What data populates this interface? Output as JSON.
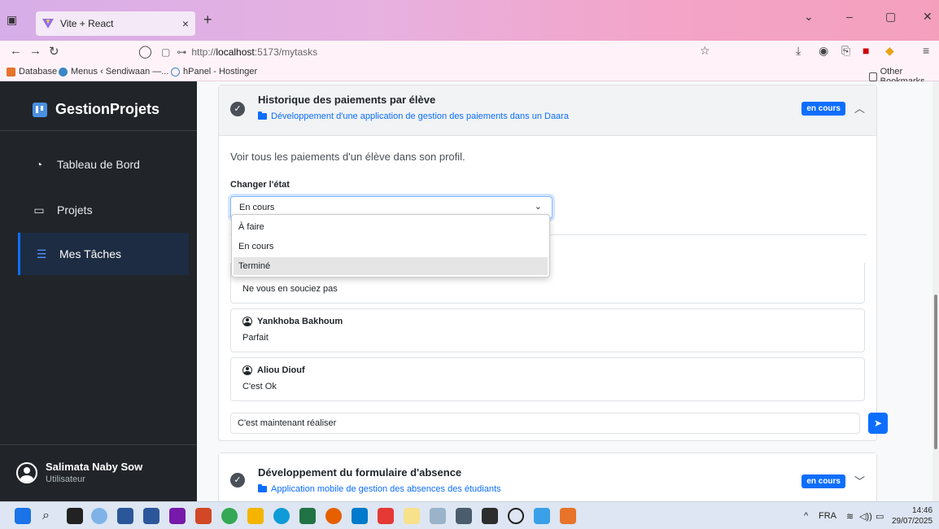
{
  "browser": {
    "tab_title": "Vite + React",
    "tab_close": "×",
    "new_tab": "+",
    "url_prefix": "http://",
    "url_host": "localhost",
    "url_rest": ":5173/mytasks",
    "bookmarks": [
      {
        "label": "Database",
        "color": "#e8732a"
      },
      {
        "label": "Menus ‹ Sendiwaan —...",
        "color": "#3b87c6"
      },
      {
        "label": "hPanel - Hostinger",
        "color": "#3b87c6"
      }
    ],
    "other_bookmarks": "Other Bookmarks"
  },
  "sidebar": {
    "brand": "GestionProjets",
    "items": [
      {
        "label": "Tableau de Bord",
        "icon": "gauge-icon"
      },
      {
        "label": "Projets",
        "icon": "folder-icon"
      },
      {
        "label": "Mes Tâches",
        "icon": "list-icon"
      }
    ],
    "user": {
      "name": "Salimata Naby Sow",
      "role": "Utilisateur"
    }
  },
  "task1": {
    "title": "Historique des paiements par élève",
    "project": "Développement d'une application de gestion des paiements dans un Daara",
    "status_badge": "en cours",
    "description": "Voir tous les paiements d'un élève dans son profil.",
    "state_label": "Changer l'état",
    "state_value": "En cours",
    "state_options": [
      "À faire",
      "En cours",
      "Terminé"
    ],
    "comments": [
      {
        "author": "",
        "text": "Ne vous en souciez pas"
      },
      {
        "author": "Yankhoba Bakhoum",
        "text": "Parfait"
      },
      {
        "author": "Aliou Diouf",
        "text": "C'est Ok"
      }
    ],
    "comment_input_value": "C'est maintenant réaliser"
  },
  "task2": {
    "title": "Développement du formulaire d'absence",
    "project": "Application mobile de gestion des absences des étudiants",
    "status_badge": "en cours"
  },
  "taskbar": {
    "lang": "FRA",
    "time": "14:46",
    "date": "29/07/2025"
  },
  "colors": {
    "primary": "#0d6efd",
    "sidebar_bg": "#212529"
  }
}
